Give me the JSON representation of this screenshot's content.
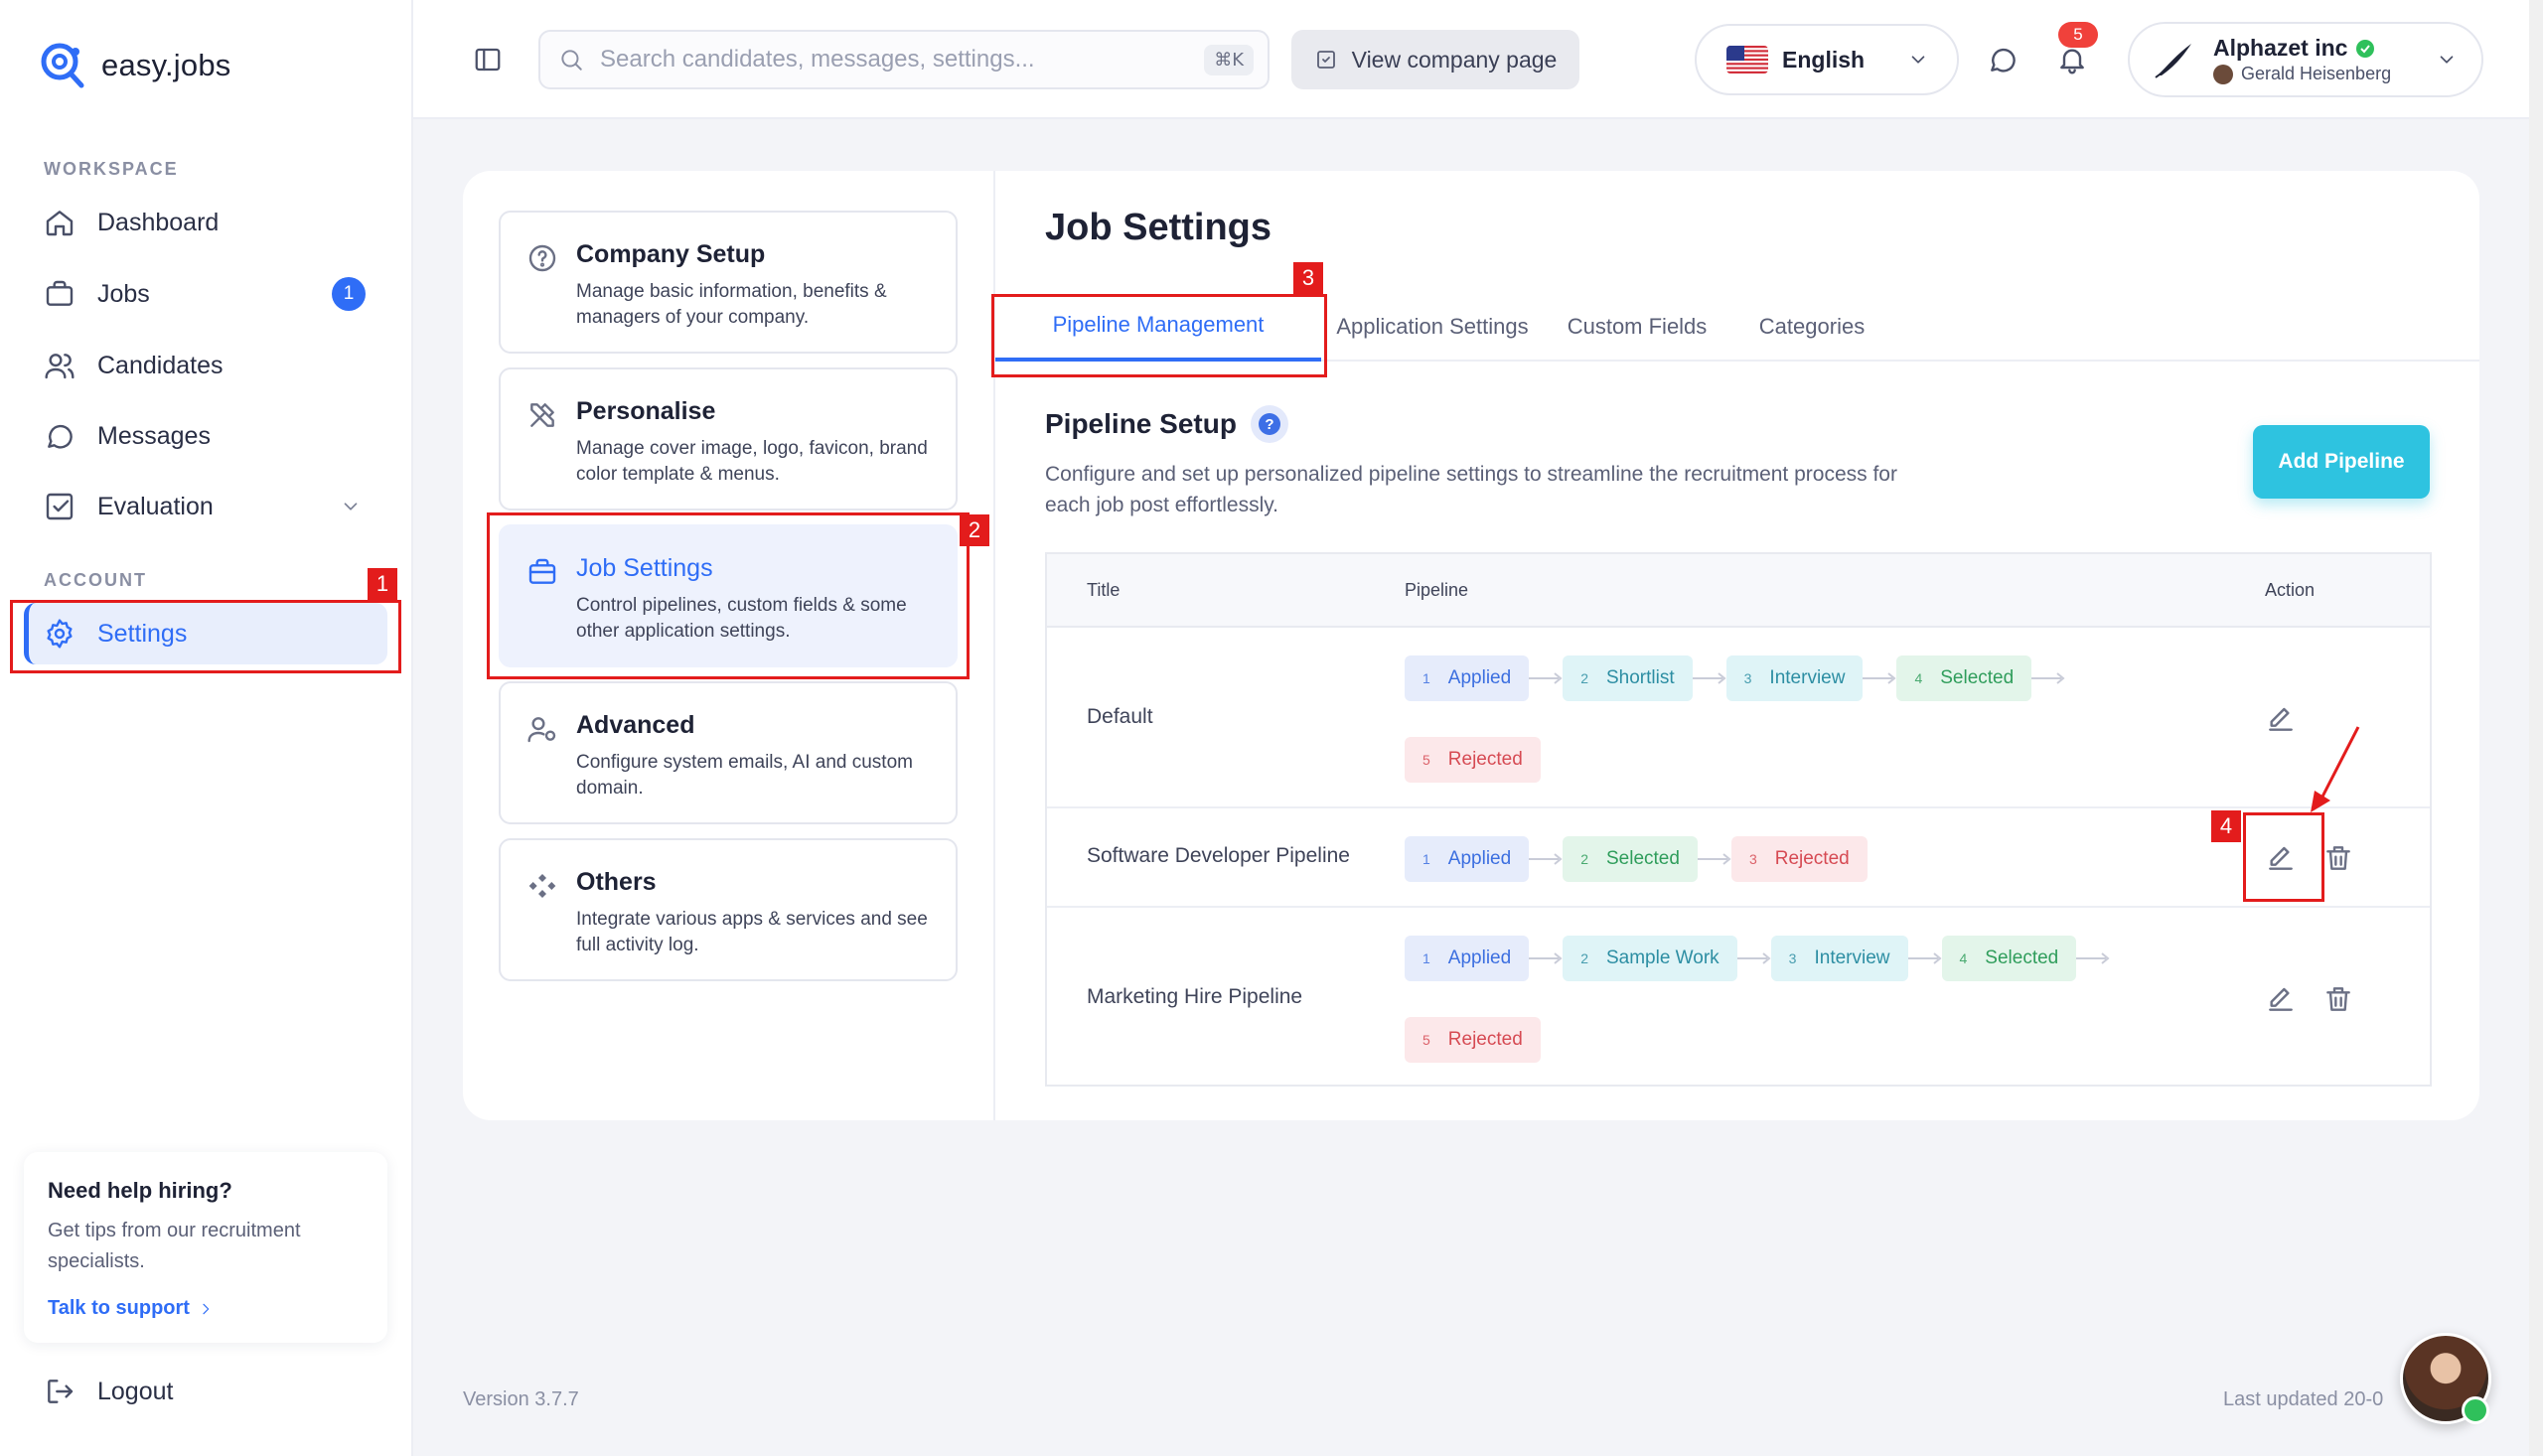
{
  "app": {
    "name": "easy.jobs"
  },
  "sidebar": {
    "workspace_label": "WORKSPACE",
    "account_label": "ACCOUNT",
    "items": [
      {
        "label": "Dashboard",
        "icon": "home-icon"
      },
      {
        "label": "Jobs",
        "icon": "briefcase-icon",
        "badge": "1"
      },
      {
        "label": "Candidates",
        "icon": "users-icon"
      },
      {
        "label": "Messages",
        "icon": "chat-icon"
      },
      {
        "label": "Evaluation",
        "icon": "checkbox-icon"
      }
    ],
    "settings_label": "Settings",
    "help": {
      "title": "Need help hiring?",
      "text": "Get tips from our recruitment specialists.",
      "link": "Talk to support"
    },
    "logout_label": "Logout"
  },
  "topbar": {
    "search_placeholder": "Search candidates, messages, settings...",
    "search_shortcut": "⌘K",
    "company_page_label": "View company page",
    "language": "English",
    "notification_count": "5",
    "account": {
      "company": "Alphazet inc",
      "user": "Gerald Heisenberg"
    }
  },
  "settings_menu": [
    {
      "title": "Company Setup",
      "desc": "Manage basic information, benefits & managers of your company."
    },
    {
      "title": "Personalise",
      "desc": "Manage cover image, logo, favicon, brand color template & menus."
    },
    {
      "title": "Job Settings",
      "desc": "Control pipelines, custom fields & some other application settings."
    },
    {
      "title": "Advanced",
      "desc": "Configure system emails, AI and custom domain."
    },
    {
      "title": "Others",
      "desc": "Integrate various apps & services and see full activity log."
    }
  ],
  "content": {
    "title": "Job Settings",
    "tabs": [
      "Pipeline Management",
      "Application Settings",
      "Custom Fields",
      "Categories"
    ],
    "section_title": "Pipeline Setup",
    "section_help_glyph": "?",
    "section_desc": "Configure and set up personalized pipeline settings to streamline the recruitment process for each job post effortlessly.",
    "add_button": "Add Pipeline",
    "table": {
      "headers": {
        "title": "Title",
        "pipeline": "Pipeline",
        "action": "Action"
      },
      "rows": [
        {
          "title": "Default",
          "stages": [
            {
              "num": "1",
              "label": "Applied",
              "tone": "blue"
            },
            {
              "num": "2",
              "label": "Shortlist",
              "tone": "teal"
            },
            {
              "num": "3",
              "label": "Interview",
              "tone": "teal"
            },
            {
              "num": "4",
              "label": "Selected",
              "tone": "green"
            },
            {
              "num": "5",
              "label": "Rejected",
              "tone": "red"
            }
          ],
          "deletable": false
        },
        {
          "title": "Software Developer Pipeline",
          "stages": [
            {
              "num": "1",
              "label": "Applied",
              "tone": "blue"
            },
            {
              "num": "2",
              "label": "Selected",
              "tone": "green"
            },
            {
              "num": "3",
              "label": "Rejected",
              "tone": "red"
            }
          ],
          "deletable": true
        },
        {
          "title": "Marketing Hire Pipeline",
          "stages": [
            {
              "num": "1",
              "label": "Applied",
              "tone": "blue"
            },
            {
              "num": "2",
              "label": "Sample Work",
              "tone": "teal"
            },
            {
              "num": "3",
              "label": "Interview",
              "tone": "teal"
            },
            {
              "num": "4",
              "label": "Selected",
              "tone": "green"
            },
            {
              "num": "5",
              "label": "Rejected",
              "tone": "red"
            }
          ],
          "deletable": true
        }
      ]
    }
  },
  "annotations": [
    "1",
    "2",
    "3",
    "4"
  ],
  "footer": {
    "version": "Version 3.7.7",
    "last_updated": "Last updated 20-0"
  },
  "colors": {
    "accent": "#2f6df6",
    "annotation": "#e31c1c",
    "add_button": "#2ec3e0"
  }
}
